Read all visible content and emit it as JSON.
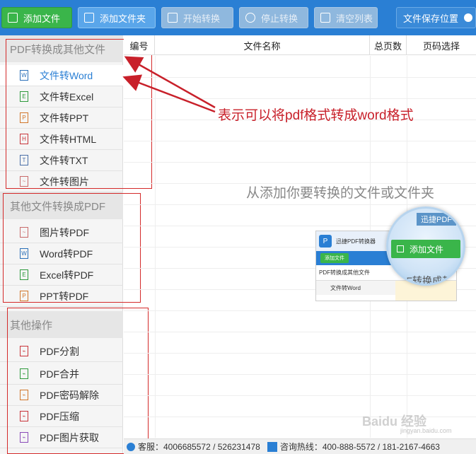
{
  "toolbar": {
    "add_file": "添加文件",
    "add_folder": "添加文件夹",
    "start": "开始转换",
    "stop": "停止转换",
    "clear": "清空列表",
    "save_location": "文件保存位置"
  },
  "sidebar": {
    "section1": {
      "title": "PDF转换成其他文件",
      "items": [
        {
          "label": "文件转Word",
          "icon": "W"
        },
        {
          "label": "文件转Excel",
          "icon": "E"
        },
        {
          "label": "文件转PPT",
          "icon": "P"
        },
        {
          "label": "文件转HTML",
          "icon": "H"
        },
        {
          "label": "文件转TXT",
          "icon": "T"
        },
        {
          "label": "文件转图片",
          "icon": "~"
        }
      ]
    },
    "section2": {
      "title": "其他文件转换成PDF",
      "items": [
        {
          "label": "图片转PDF",
          "icon": "~"
        },
        {
          "label": "Word转PDF",
          "icon": "W"
        },
        {
          "label": "Excel转PDF",
          "icon": "E"
        },
        {
          "label": "PPT转PDF",
          "icon": "P"
        }
      ]
    },
    "section3": {
      "title": "其他操作",
      "items": [
        {
          "label": "PDF分割"
        },
        {
          "label": "PDF合并"
        },
        {
          "label": "PDF密码解除"
        },
        {
          "label": "PDF压缩"
        },
        {
          "label": "PDF图片获取"
        }
      ]
    }
  },
  "table": {
    "col_no": "编号",
    "col_name": "文件名称",
    "col_pages": "总页数",
    "col_range": "页码选择"
  },
  "hint": "从添加你要转换的文件或文件夹",
  "annotation": "表示可以将pdf格式转成word格式",
  "illustration": {
    "app_title": "迅捷PDF转换器",
    "add_file": "添加文件",
    "row1": "PDF转换成其他文件",
    "row2": "文件转Word",
    "magnifier_title": "迅捷PDF",
    "magnifier_btn": "添加文件",
    "magnifier_text": "PDF转换成其"
  },
  "status": {
    "service": "客服：4006685572 / 526231478",
    "phone": "咨询热线：400-888-5572 / 181-2167-4663"
  },
  "watermark": {
    "text": "Baidu 经验",
    "url": "jingyan.baidu.com"
  },
  "colors": {
    "toolbar_bg": "#2a7fd4",
    "annotation_red": "#c8202a",
    "active_blue": "#2a7fd4"
  }
}
